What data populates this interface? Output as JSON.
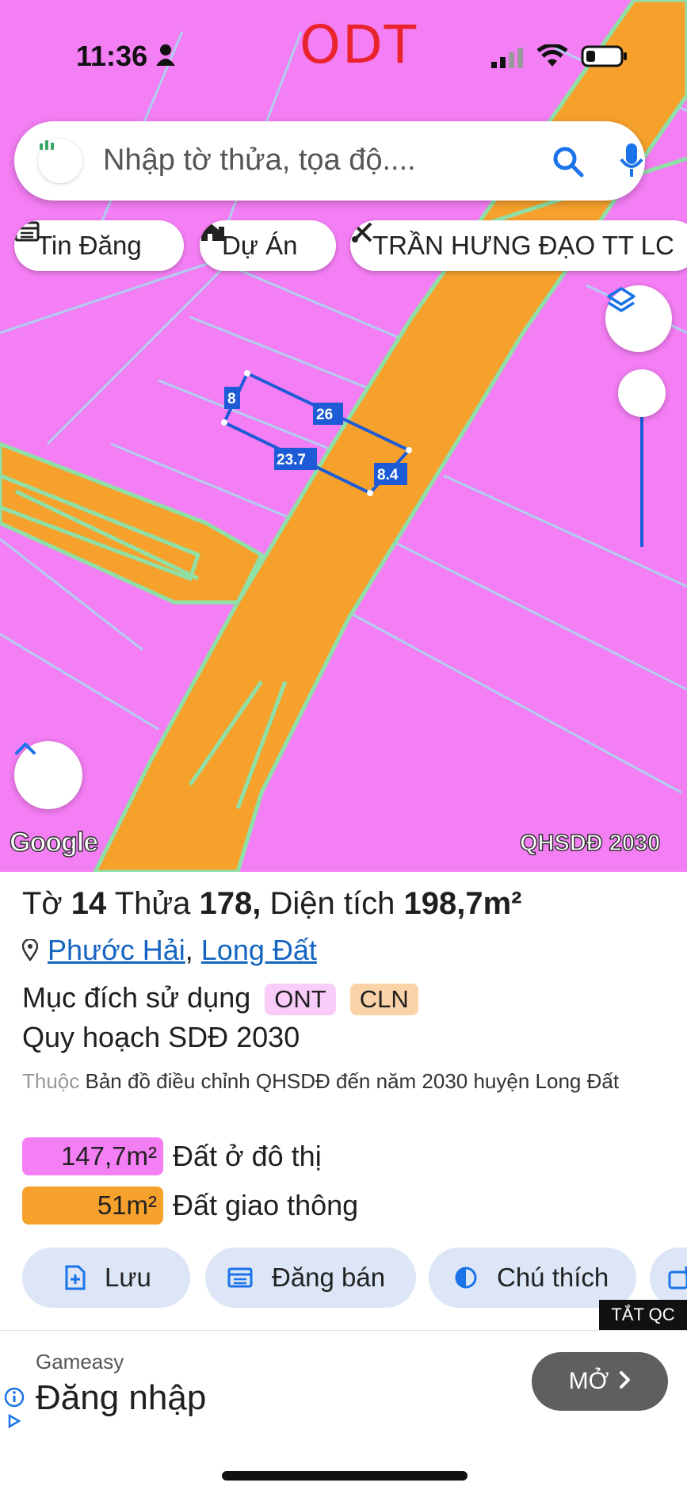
{
  "status_bar": {
    "time": "11:36"
  },
  "map": {
    "zone_label": "ODT",
    "search": {
      "placeholder": "Nhập tờ thửa, tọa độ...."
    },
    "chips": [
      "Tin Đăng",
      "Dự Án",
      "TRẦN HƯNG ĐẠO TT LC"
    ],
    "parcel_edges": [
      "8",
      "26",
      "23.7",
      "8.4"
    ],
    "attribution": "Google",
    "layer_name": "QHSDĐ 2030",
    "colors": {
      "residential": "#f47ef4",
      "road": "#f7a12d",
      "lines": "#8fe0a6",
      "parcel": "#1e5bd6"
    }
  },
  "parcel_info": {
    "sheet_label": "Tờ",
    "sheet": "14",
    "plot_label": "Thửa",
    "plot": "178,",
    "area_label": "Diện tích",
    "area": "198,7m²",
    "ward": "Phước Hải",
    "district": "Long Đất",
    "purpose_label": "Mục đích sử dụng",
    "purpose_tags": [
      {
        "code": "ONT",
        "color": "#f9cdf9"
      },
      {
        "code": "CLN",
        "color": "#fbd3a8"
      }
    ],
    "plan_label": "Quy hoạch SDĐ 2030",
    "belongs_prefix": "Thuộc",
    "belongs_text": "Bản đồ điều chỉnh QHSDĐ đến năm 2030 huyện Long Đất",
    "areas": [
      {
        "value": "147,7m²",
        "label": "Đất ở đô thị",
        "color": "#f47ef4"
      },
      {
        "value": "51m²",
        "label": "Đất giao thông",
        "color": "#f7a12d"
      }
    ]
  },
  "actions": [
    "Lưu",
    "Đăng bán",
    "Chú thích"
  ],
  "ad": {
    "close_label": "TẮT QC",
    "brand": "Gameasy",
    "title": "Đăng nhập",
    "open_label": "MỞ"
  }
}
